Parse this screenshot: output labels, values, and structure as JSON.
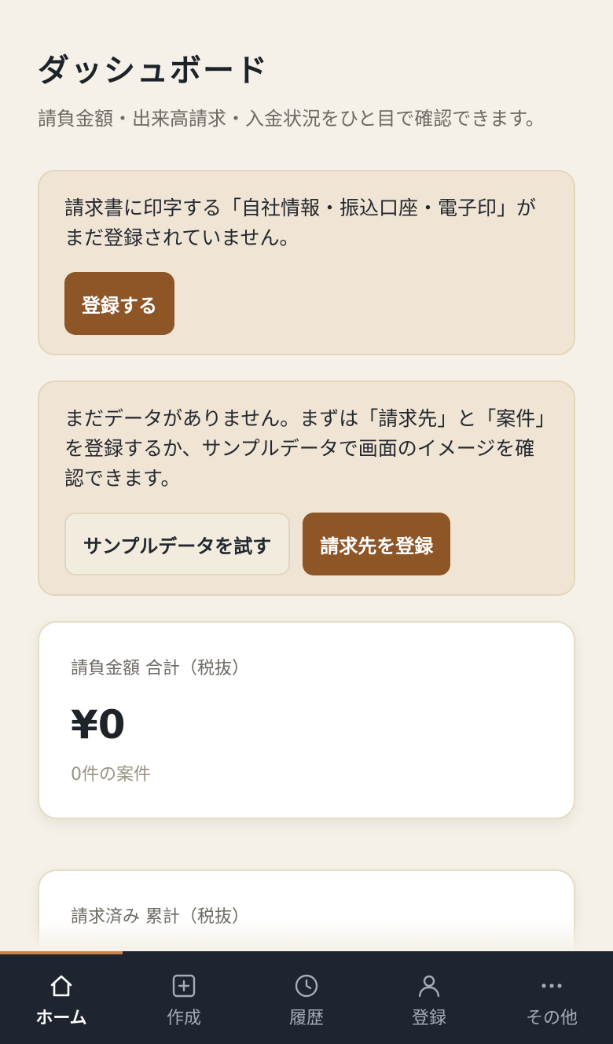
{
  "header": {
    "title": "ダッシュボード",
    "subtitle": "請負金額・出来高請求・入金状況をひと目で確認できます。"
  },
  "company_notice": {
    "text": "請求書に印字する「自社情報・振込口座・電子印」がまだ登録されていません。",
    "register_button": "登録する"
  },
  "empty_notice": {
    "text": "まだデータがありません。まずは「請求先」と「案件」を登録するか、サンプルデータで画面のイメージを確認できます。",
    "sample_button": "サンプルデータを試す",
    "register_client_button": "請求先を登録"
  },
  "stats": [
    {
      "label": "請負金額 合計（税抜）",
      "value": "¥0",
      "sub": "0件の案件"
    },
    {
      "label": "請求済み 累計（税抜）"
    }
  ],
  "nav": {
    "items": [
      {
        "label": "ホーム",
        "icon": "home-icon",
        "active": true
      },
      {
        "label": "作成",
        "icon": "plus-square-icon",
        "active": false
      },
      {
        "label": "履歴",
        "icon": "clock-icon",
        "active": false
      },
      {
        "label": "登録",
        "icon": "user-icon",
        "active": false
      },
      {
        "label": "その他",
        "icon": "more-icon",
        "active": false
      }
    ]
  },
  "colors": {
    "background": "#f5f1e8",
    "accent": "#8e5527",
    "nav_background": "#1e2530",
    "nav_indicator": "#c8844a",
    "notice_background": "#f0e5d4"
  }
}
